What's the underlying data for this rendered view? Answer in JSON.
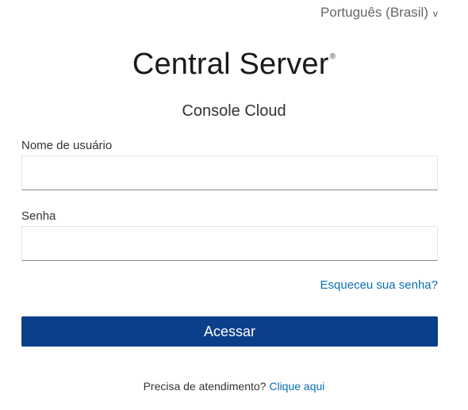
{
  "language": {
    "selected": "Português (Brasil)",
    "chevron_glyph": "v",
    "chevron_icon": "chevron-down-icon"
  },
  "brand": {
    "logo_text": "Central Server",
    "registered_mark": "®"
  },
  "subtitle": "Console Cloud",
  "form": {
    "username_label": "Nome de usuário",
    "username_value": "",
    "password_label": "Senha",
    "password_value": "",
    "forgot_link": "Esqueceu sua senha?",
    "submit_label": "Acessar"
  },
  "footer": {
    "help_text": "Precisa de atendimento?",
    "help_link": "Clique aqui"
  },
  "colors": {
    "primary_button": "#0b3f8a",
    "link": "#0a6fb8"
  }
}
